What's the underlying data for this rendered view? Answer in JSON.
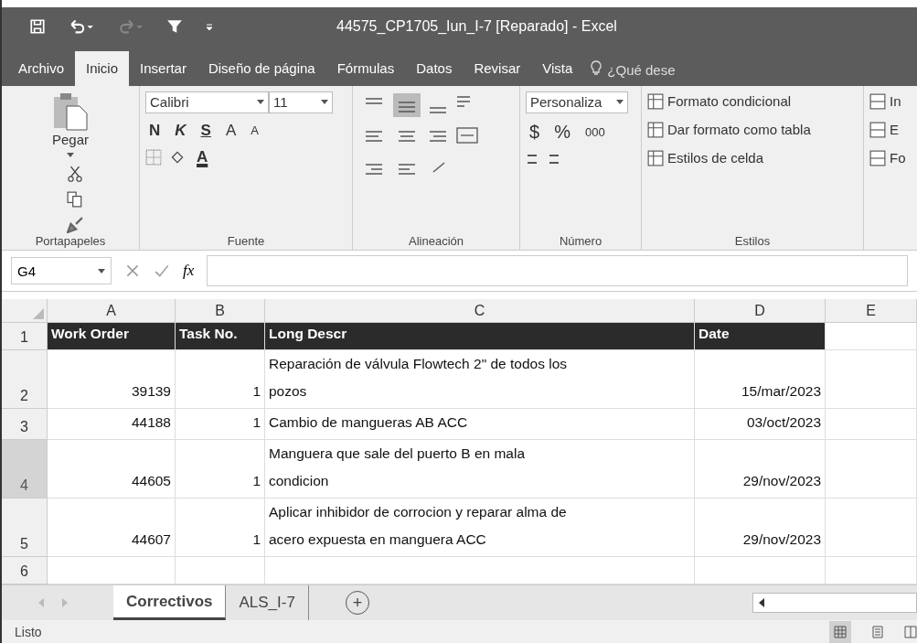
{
  "window": {
    "title": "44575_CP1705_Iun_I-7 [Reparado] - Excel"
  },
  "ribbon_tabs": [
    {
      "label": "Archivo",
      "selected": false
    },
    {
      "label": "Inicio",
      "selected": true
    },
    {
      "label": "Insertar",
      "selected": false
    },
    {
      "label": "Diseño de página",
      "selected": false
    },
    {
      "label": "Fórmulas",
      "selected": false
    },
    {
      "label": "Datos",
      "selected": false
    },
    {
      "label": "Revisar",
      "selected": false
    },
    {
      "label": "Vista",
      "selected": false
    }
  ],
  "tell_me": {
    "placeholder": "¿Qué dese"
  },
  "ribbon": {
    "clipboard": {
      "paste": "Pegar",
      "label": "Portapapeles"
    },
    "font": {
      "name": "Calibri",
      "size": "11",
      "bold": "N",
      "italic": "K",
      "underline": "S",
      "grow": "A",
      "shrink": "A",
      "text_color": "A",
      "label": "Fuente"
    },
    "alignment": {
      "label": "Alineación"
    },
    "number": {
      "format": "Personaliza",
      "currency": "$",
      "percent": "%",
      "thousands": "000",
      "label": "Número"
    },
    "styles": {
      "items": [
        "Formato condicional",
        "Dar formato como tabla",
        "Estilos de celda"
      ],
      "label": "Estilos"
    },
    "cells": {
      "items": [
        "In",
        "E",
        "Fo"
      ]
    }
  },
  "formula_bar": {
    "name_box": "G4",
    "fx": "fx"
  },
  "columns": [
    "A",
    "B",
    "C",
    "D",
    "E"
  ],
  "rows": [
    {
      "number": "1",
      "selected": false,
      "kind": "header",
      "cells": [
        "Work Order",
        "Task No.",
        "Long Descr",
        "Date"
      ]
    },
    {
      "number": "2",
      "selected": false,
      "kind": "data",
      "cells": [
        "39139",
        "1",
        "Reparación de válvula Flowtech 2\" de todos los pozos",
        "15/mar/2023"
      ]
    },
    {
      "number": "3",
      "selected": false,
      "kind": "data",
      "cells": [
        "44188",
        "1",
        "Cambio de mangueras AB ACC",
        "03/oct/2023"
      ]
    },
    {
      "number": "4",
      "selected": true,
      "kind": "data",
      "cells": [
        "44605",
        "1",
        "Manguera que sale del puerto B en mala condicion",
        "29/nov/2023"
      ]
    },
    {
      "number": "5",
      "selected": false,
      "kind": "data",
      "cells": [
        "44607",
        "1",
        "Aplicar inhibidor de corrocion y reparar alma de acero expuesta en manguera ACC",
        "29/nov/2023"
      ]
    },
    {
      "number": "6",
      "selected": false,
      "kind": "data",
      "cells": []
    }
  ],
  "sheet_tabs": [
    {
      "label": "Correctivos",
      "selected": true
    },
    {
      "label": "ALS_I-7",
      "selected": false
    }
  ],
  "add_sheet": "+",
  "status_bar": {
    "text": "Listo"
  }
}
